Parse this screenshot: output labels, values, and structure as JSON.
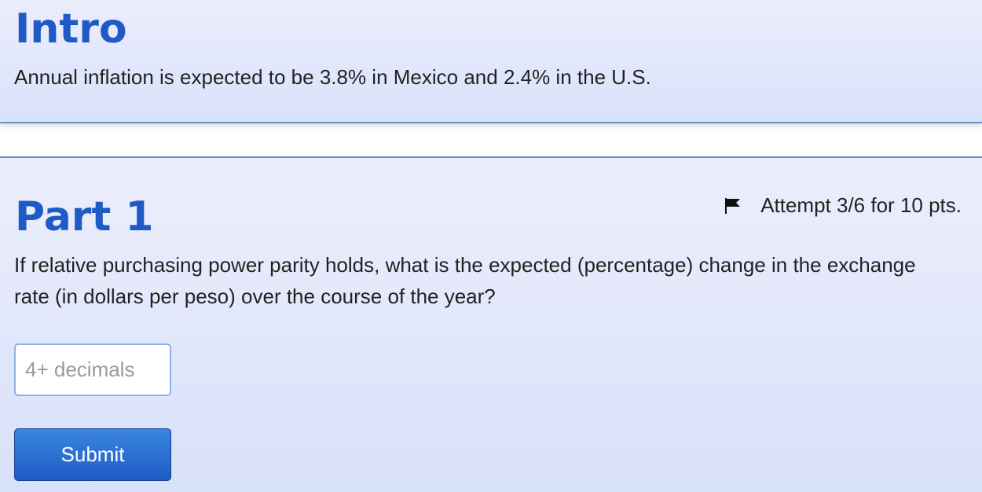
{
  "intro": {
    "title": "Intro",
    "text": "Annual inflation is expected to be 3.8% in Mexico and 2.4% in the U.S."
  },
  "part1": {
    "title": "Part 1",
    "attempt": "Attempt 3/6 for 10 pts.",
    "question": "If relative purchasing power parity holds, what is the expected (percentage) change in the exchange rate (in dollars per peso) over the course of the year?",
    "answer_value": "",
    "answer_placeholder": "4+ decimals",
    "submit_label": "Submit",
    "flag_icon": "flag-icon"
  },
  "colors": {
    "heading": "#1f5bc6",
    "submit_button": "#2a6fd4",
    "input_border": "#8db3e6"
  }
}
